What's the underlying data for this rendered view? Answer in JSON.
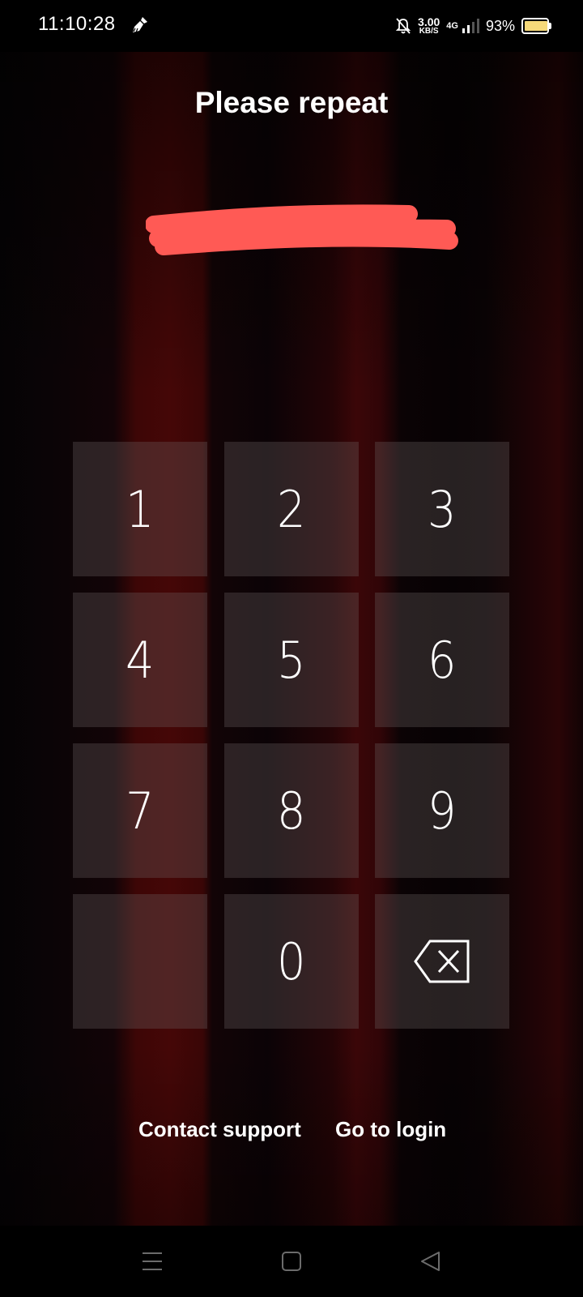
{
  "status_bar": {
    "time": "11:10:28",
    "speed_value": "3.00",
    "speed_unit": "KB/S",
    "network": "4G",
    "battery_percent": "93%",
    "battery_level": 0.93,
    "battery_color": "#f6d97a"
  },
  "title": "Please repeat",
  "keypad": {
    "keys": [
      "1",
      "2",
      "3",
      "4",
      "5",
      "6",
      "7",
      "8",
      "9",
      "",
      "0"
    ],
    "backspace_icon": "backspace-icon"
  },
  "links": {
    "contact_support": "Contact support",
    "go_to_login": "Go to login"
  },
  "colors": {
    "redaction": "#ff5a55",
    "key_background": "rgba(110,100,100,0.32)"
  },
  "nav_bar": {
    "icons": [
      "menu-icon",
      "home-square-icon",
      "back-triangle-icon"
    ]
  }
}
